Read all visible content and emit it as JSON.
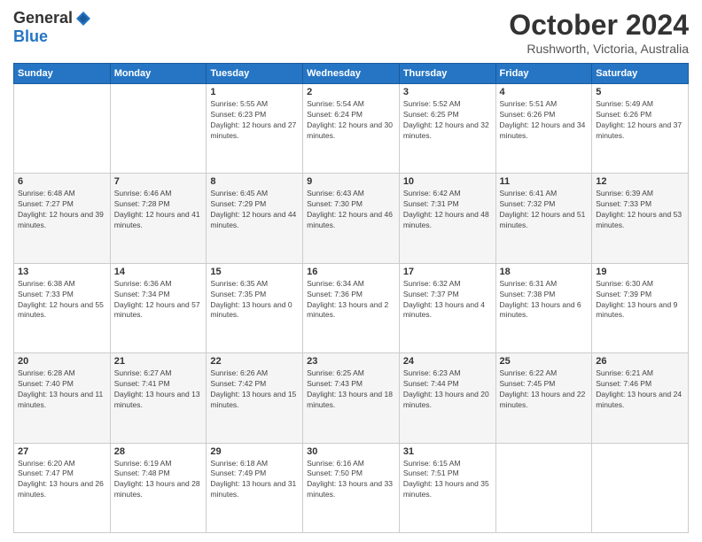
{
  "logo": {
    "general": "General",
    "blue": "Blue"
  },
  "title": "October 2024",
  "subtitle": "Rushworth, Victoria, Australia",
  "days_header": [
    "Sunday",
    "Monday",
    "Tuesday",
    "Wednesday",
    "Thursday",
    "Friday",
    "Saturday"
  ],
  "weeks": [
    [
      {
        "day": "",
        "sunrise": "",
        "sunset": "",
        "daylight": ""
      },
      {
        "day": "",
        "sunrise": "",
        "sunset": "",
        "daylight": ""
      },
      {
        "day": "1",
        "sunrise": "Sunrise: 5:55 AM",
        "sunset": "Sunset: 6:23 PM",
        "daylight": "Daylight: 12 hours and 27 minutes."
      },
      {
        "day": "2",
        "sunrise": "Sunrise: 5:54 AM",
        "sunset": "Sunset: 6:24 PM",
        "daylight": "Daylight: 12 hours and 30 minutes."
      },
      {
        "day": "3",
        "sunrise": "Sunrise: 5:52 AM",
        "sunset": "Sunset: 6:25 PM",
        "daylight": "Daylight: 12 hours and 32 minutes."
      },
      {
        "day": "4",
        "sunrise": "Sunrise: 5:51 AM",
        "sunset": "Sunset: 6:26 PM",
        "daylight": "Daylight: 12 hours and 34 minutes."
      },
      {
        "day": "5",
        "sunrise": "Sunrise: 5:49 AM",
        "sunset": "Sunset: 6:26 PM",
        "daylight": "Daylight: 12 hours and 37 minutes."
      }
    ],
    [
      {
        "day": "6",
        "sunrise": "Sunrise: 6:48 AM",
        "sunset": "Sunset: 7:27 PM",
        "daylight": "Daylight: 12 hours and 39 minutes."
      },
      {
        "day": "7",
        "sunrise": "Sunrise: 6:46 AM",
        "sunset": "Sunset: 7:28 PM",
        "daylight": "Daylight: 12 hours and 41 minutes."
      },
      {
        "day": "8",
        "sunrise": "Sunrise: 6:45 AM",
        "sunset": "Sunset: 7:29 PM",
        "daylight": "Daylight: 12 hours and 44 minutes."
      },
      {
        "day": "9",
        "sunrise": "Sunrise: 6:43 AM",
        "sunset": "Sunset: 7:30 PM",
        "daylight": "Daylight: 12 hours and 46 minutes."
      },
      {
        "day": "10",
        "sunrise": "Sunrise: 6:42 AM",
        "sunset": "Sunset: 7:31 PM",
        "daylight": "Daylight: 12 hours and 48 minutes."
      },
      {
        "day": "11",
        "sunrise": "Sunrise: 6:41 AM",
        "sunset": "Sunset: 7:32 PM",
        "daylight": "Daylight: 12 hours and 51 minutes."
      },
      {
        "day": "12",
        "sunrise": "Sunrise: 6:39 AM",
        "sunset": "Sunset: 7:33 PM",
        "daylight": "Daylight: 12 hours and 53 minutes."
      }
    ],
    [
      {
        "day": "13",
        "sunrise": "Sunrise: 6:38 AM",
        "sunset": "Sunset: 7:33 PM",
        "daylight": "Daylight: 12 hours and 55 minutes."
      },
      {
        "day": "14",
        "sunrise": "Sunrise: 6:36 AM",
        "sunset": "Sunset: 7:34 PM",
        "daylight": "Daylight: 12 hours and 57 minutes."
      },
      {
        "day": "15",
        "sunrise": "Sunrise: 6:35 AM",
        "sunset": "Sunset: 7:35 PM",
        "daylight": "Daylight: 13 hours and 0 minutes."
      },
      {
        "day": "16",
        "sunrise": "Sunrise: 6:34 AM",
        "sunset": "Sunset: 7:36 PM",
        "daylight": "Daylight: 13 hours and 2 minutes."
      },
      {
        "day": "17",
        "sunrise": "Sunrise: 6:32 AM",
        "sunset": "Sunset: 7:37 PM",
        "daylight": "Daylight: 13 hours and 4 minutes."
      },
      {
        "day": "18",
        "sunrise": "Sunrise: 6:31 AM",
        "sunset": "Sunset: 7:38 PM",
        "daylight": "Daylight: 13 hours and 6 minutes."
      },
      {
        "day": "19",
        "sunrise": "Sunrise: 6:30 AM",
        "sunset": "Sunset: 7:39 PM",
        "daylight": "Daylight: 13 hours and 9 minutes."
      }
    ],
    [
      {
        "day": "20",
        "sunrise": "Sunrise: 6:28 AM",
        "sunset": "Sunset: 7:40 PM",
        "daylight": "Daylight: 13 hours and 11 minutes."
      },
      {
        "day": "21",
        "sunrise": "Sunrise: 6:27 AM",
        "sunset": "Sunset: 7:41 PM",
        "daylight": "Daylight: 13 hours and 13 minutes."
      },
      {
        "day": "22",
        "sunrise": "Sunrise: 6:26 AM",
        "sunset": "Sunset: 7:42 PM",
        "daylight": "Daylight: 13 hours and 15 minutes."
      },
      {
        "day": "23",
        "sunrise": "Sunrise: 6:25 AM",
        "sunset": "Sunset: 7:43 PM",
        "daylight": "Daylight: 13 hours and 18 minutes."
      },
      {
        "day": "24",
        "sunrise": "Sunrise: 6:23 AM",
        "sunset": "Sunset: 7:44 PM",
        "daylight": "Daylight: 13 hours and 20 minutes."
      },
      {
        "day": "25",
        "sunrise": "Sunrise: 6:22 AM",
        "sunset": "Sunset: 7:45 PM",
        "daylight": "Daylight: 13 hours and 22 minutes."
      },
      {
        "day": "26",
        "sunrise": "Sunrise: 6:21 AM",
        "sunset": "Sunset: 7:46 PM",
        "daylight": "Daylight: 13 hours and 24 minutes."
      }
    ],
    [
      {
        "day": "27",
        "sunrise": "Sunrise: 6:20 AM",
        "sunset": "Sunset: 7:47 PM",
        "daylight": "Daylight: 13 hours and 26 minutes."
      },
      {
        "day": "28",
        "sunrise": "Sunrise: 6:19 AM",
        "sunset": "Sunset: 7:48 PM",
        "daylight": "Daylight: 13 hours and 28 minutes."
      },
      {
        "day": "29",
        "sunrise": "Sunrise: 6:18 AM",
        "sunset": "Sunset: 7:49 PM",
        "daylight": "Daylight: 13 hours and 31 minutes."
      },
      {
        "day": "30",
        "sunrise": "Sunrise: 6:16 AM",
        "sunset": "Sunset: 7:50 PM",
        "daylight": "Daylight: 13 hours and 33 minutes."
      },
      {
        "day": "31",
        "sunrise": "Sunrise: 6:15 AM",
        "sunset": "Sunset: 7:51 PM",
        "daylight": "Daylight: 13 hours and 35 minutes."
      },
      {
        "day": "",
        "sunrise": "",
        "sunset": "",
        "daylight": ""
      },
      {
        "day": "",
        "sunrise": "",
        "sunset": "",
        "daylight": ""
      }
    ]
  ]
}
